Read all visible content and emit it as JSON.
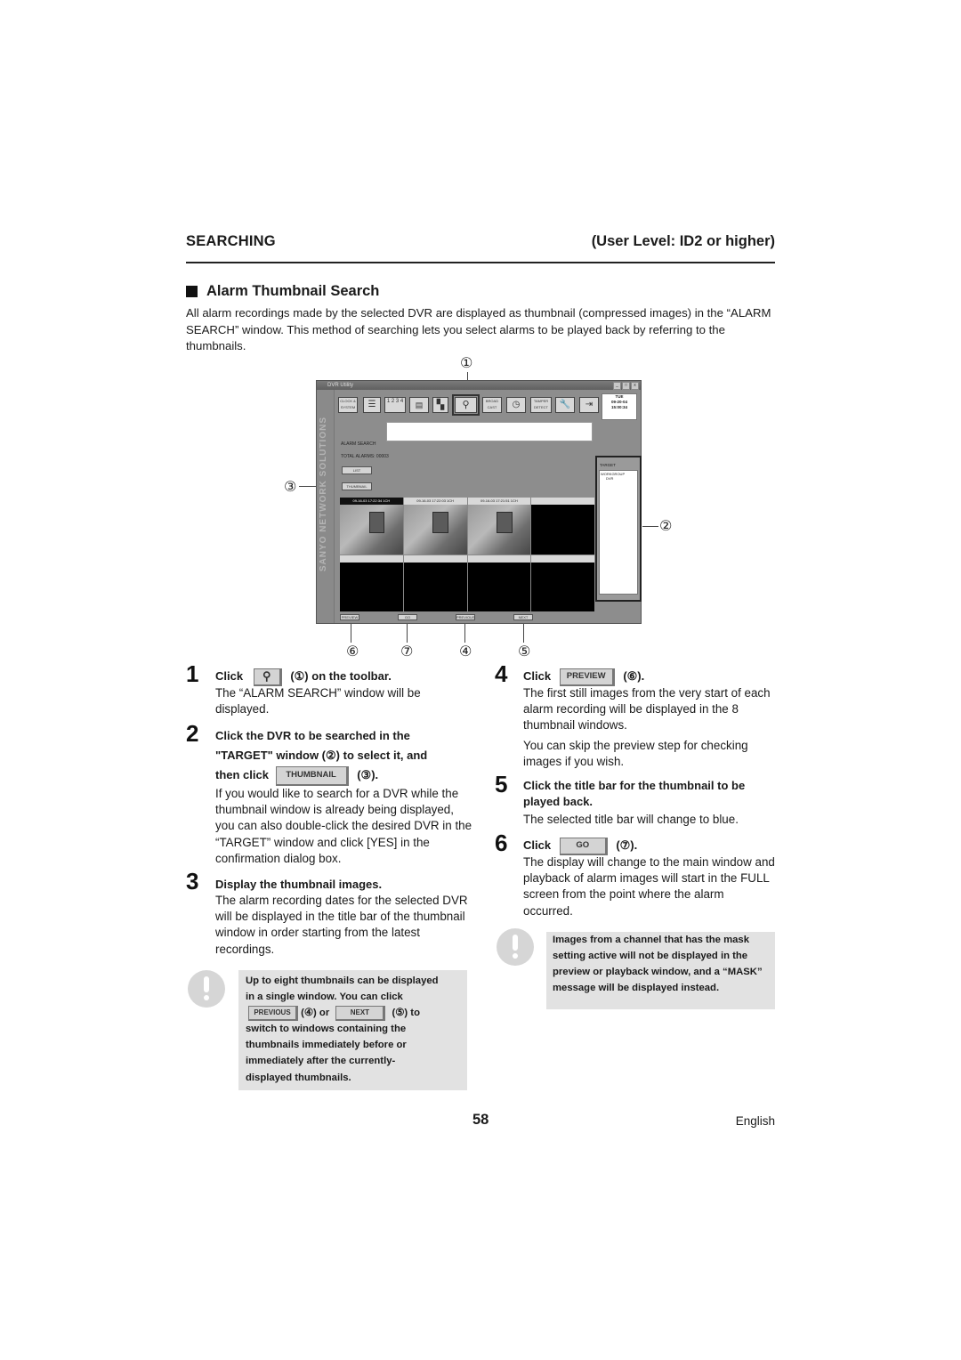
{
  "header": {
    "section": "SEARCHING",
    "user_level": "(User Level: ID2 or higher)"
  },
  "title": "Alarm Thumbnail Search",
  "intro": "All alarm recordings made by the selected DVR are displayed as thumbnail (compressed images) in the “ALARM SEARCH” window. This method of searching lets you select alarms to be played back by referring to the thumbnails.",
  "callouts": [
    "①",
    "②",
    "③",
    "④",
    "⑤",
    "⑥",
    "⑦"
  ],
  "screenshot": {
    "window_title": "DVR Utility",
    "window_buttons": [
      "_",
      "□",
      "x"
    ],
    "side_brand": "SANYO NETWORK SOLUTIONS",
    "toolbar": [
      {
        "label": "CLOCK & SYSTEM",
        "icon": "clock-system-icon"
      },
      {
        "label": "",
        "icon": "list-icon"
      },
      {
        "label": "1 2 3 4",
        "icon": "camera-select-icon"
      },
      {
        "label": "",
        "icon": "multi-screen-icon"
      },
      {
        "label": "",
        "icon": "quad-screen-icon"
      },
      {
        "label": "",
        "icon": "search-icon",
        "selected": true
      },
      {
        "label": "BROAD CAST",
        "icon": "broadcast-icon"
      },
      {
        "label": "",
        "icon": "timer-icon"
      },
      {
        "label": "TAMPER DETECT",
        "icon": "tamper-detect-icon"
      },
      {
        "label": "",
        "icon": "wrench-icon"
      },
      {
        "label": "",
        "icon": "exit-icon"
      }
    ],
    "clock": {
      "day": "TUE",
      "date": "09-20-04",
      "time": "15:00:34"
    },
    "alarm_search_label": "ALARM SEARCH",
    "total_alarms_label": "TOTAL ALARMS: 00003",
    "list_button": "LIST",
    "thumbnail_button": "THUMBNAIL",
    "target_label": "TARGET",
    "target_tree": [
      "WORKGROUP",
      "DVR"
    ],
    "thumbnails": [
      {
        "title": "09-16-03 17:22:34  1CH",
        "has_image": true,
        "selected": true
      },
      {
        "title": "09-16-03 17:22:03  1CH",
        "has_image": true,
        "selected": false
      },
      {
        "title": "09-16-03 17:21:51  1CH",
        "has_image": true,
        "selected": false
      },
      {
        "title": "",
        "has_image": false,
        "selected": false
      },
      {
        "title": "",
        "has_image": false,
        "selected": false
      },
      {
        "title": "",
        "has_image": false,
        "selected": false
      },
      {
        "title": "",
        "has_image": false,
        "selected": false
      },
      {
        "title": "",
        "has_image": false,
        "selected": false
      }
    ],
    "bottom_buttons": {
      "preview": "PREVIEW",
      "go": "GO",
      "previous": "PREVIOUS",
      "next": "NEXT"
    }
  },
  "steps": [
    {
      "num": "1",
      "head_pre": "Click",
      "button": "search-icon",
      "head_post": "(①) on the toolbar.",
      "body": "The “ALARM SEARCH” window will be displayed."
    },
    {
      "num": "2",
      "head_line1": "Click the DVR to be searched in the",
      "head_line2": "\"TARGET\" window (②) to select it, and",
      "head_pre": "then click",
      "button": "THUMBNAIL",
      "head_post": "(③).",
      "body": "If you would like to search for a DVR while the thumbnail window is already being displayed, you can also double-click the desired DVR in the “TARGET” window and click [YES] in the confirmation dialog box."
    },
    {
      "num": "3",
      "head": "Display the thumbnail images.",
      "body": "The alarm recording dates for the selected DVR will be displayed in the title bar of the thumbnail window in order starting from the latest recordings."
    },
    {
      "num": "4",
      "head_pre": "Click",
      "button": "PREVIEW",
      "head_post": "(⑥).",
      "body": "The first still images from the very start of each alarm recording will be displayed in the 8 thumbnail windows.",
      "body2": "You can skip the preview step for checking images if you wish."
    },
    {
      "num": "5",
      "head": "Click the title bar for the thumbnail to be played back.",
      "body": "The selected title bar will change to blue."
    },
    {
      "num": "6",
      "head_pre": "Click",
      "button": "GO",
      "head_post": "(⑦).",
      "body": "The display will change to the main window and playback of alarm images will start in the FULL screen from the point where the alarm occurred."
    }
  ],
  "notes": [
    {
      "line1": "Up to eight thumbnails can be displayed",
      "line2": "in a single window. You can click",
      "btn1": "PREVIOUS",
      "mid": "(④) or",
      "btn2": "NEXT",
      "post": "(⑤) to",
      "rest": "switch to windows containing the thumbnails immediately before or immediately after the currently-displayed thumbnails."
    },
    {
      "text": "Images from a channel that has the mask setting active will not be displayed in the preview or playback window, and a “MASK” message will be displayed instead."
    }
  ],
  "footer": {
    "page_number": "58",
    "language": "English"
  }
}
